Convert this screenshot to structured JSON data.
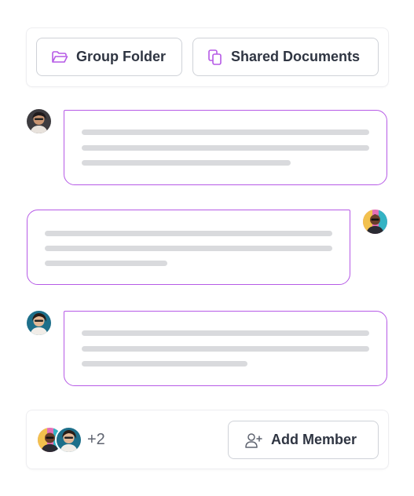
{
  "toolbar": {
    "group_folder_label": "Group Folder",
    "shared_documents_label": "Shared Documents",
    "group_folder_icon": "folder-open-icon",
    "shared_documents_icon": "copy-documents-icon"
  },
  "footer": {
    "members_extra_count": "+2",
    "add_member_label": "Add Member",
    "add_member_icon": "user-plus-icon"
  },
  "colors": {
    "accent": "#b65ae6",
    "button_border": "#cfd2d8",
    "placeholder_line": "#d9dadd",
    "text": "#2f3542"
  }
}
